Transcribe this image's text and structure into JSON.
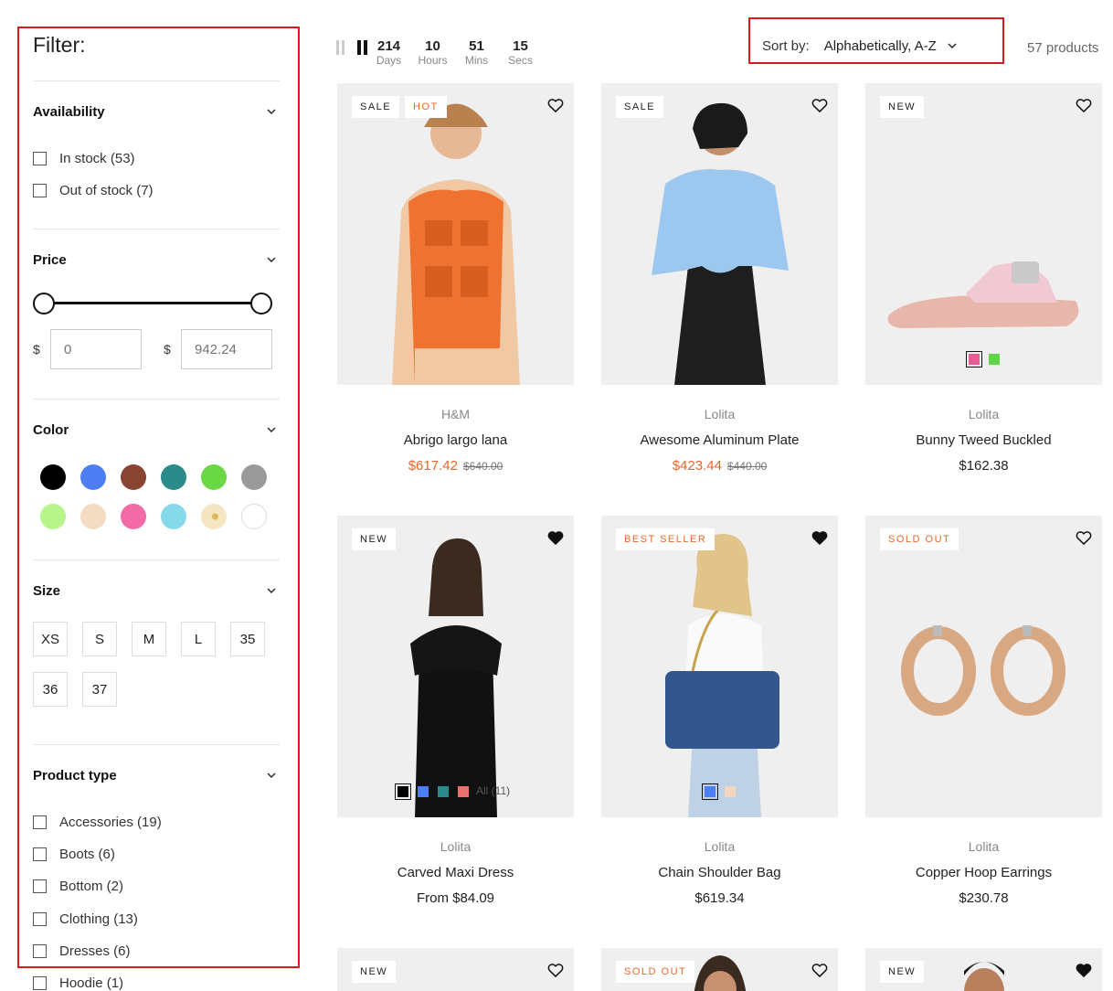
{
  "filter": {
    "title": "Filter:",
    "availability": {
      "label": "Availability",
      "options": [
        "In stock (53)",
        "Out of stock (7)"
      ]
    },
    "price": {
      "label": "Price",
      "currency": "$",
      "min_placeholder": "0",
      "max_placeholder": "942.24"
    },
    "color": {
      "label": "Color",
      "swatches": [
        "#000000",
        "#4d7ef5",
        "#8a4432",
        "#2b8a8a",
        "#6ad845",
        "#9a9a9a",
        "#b7f58a",
        "#f3dcc2",
        "#f26aa6",
        "#86d9e8",
        "#f3e6c0",
        "#ffffff"
      ]
    },
    "size": {
      "label": "Size",
      "options": [
        "XS",
        "S",
        "M",
        "L",
        "35",
        "36",
        "37"
      ]
    },
    "product_type": {
      "label": "Product type",
      "options": [
        "Accessories (19)",
        "Boots (6)",
        "Bottom (2)",
        "Clothing (13)",
        "Dresses (6)",
        "Hoodie (1)"
      ]
    }
  },
  "toolbar": {
    "sort_label": "Sort by:",
    "sort_value": "Alphabetically, A-Z",
    "count": "57 products"
  },
  "products": [
    {
      "badges": [
        "SALE",
        "HOT"
      ],
      "vendor": "H&M",
      "name": "Abrigo largo lana",
      "price": "$617.42",
      "compare": "$640.00",
      "countdown": [
        {
          "n": "214",
          "l": "Days"
        },
        {
          "n": "10",
          "l": "Hours"
        },
        {
          "n": "51",
          "l": "Mins"
        },
        {
          "n": "15",
          "l": "Secs"
        }
      ]
    },
    {
      "badges": [
        "SALE"
      ],
      "vendor": "Lolita",
      "name": "Awesome Aluminum Plate",
      "price": "$423.44",
      "compare": "$440.00"
    },
    {
      "badges": [
        "NEW"
      ],
      "vendor": "Lolita",
      "name": "Bunny Tweed Buckled",
      "price": "$162.38",
      "swatch_colors": [
        "#ea5b93",
        "#5ed645"
      ]
    },
    {
      "badges": [
        "NEW"
      ],
      "vendor": "Lolita",
      "name": "Carved Maxi Dress",
      "price": "From $84.09",
      "swatch_colors": [
        "#000000",
        "#4d7ef5",
        "#2b8a8a",
        "#e8706e"
      ],
      "swatch_all": "All (11)"
    },
    {
      "badges": [
        "BEST SELLER"
      ],
      "vendor": "Lolita",
      "name": "Chain Shoulder Bag",
      "price": "$619.34",
      "swatch_colors": [
        "#4d7ef5",
        "#f3d5c0"
      ]
    },
    {
      "badges": [
        "SOLD OUT"
      ],
      "vendor": "Lolita",
      "name": "Copper Hoop Earrings",
      "price": "$230.78"
    },
    {
      "badges": [
        "NEW"
      ]
    },
    {
      "badges": [
        "SOLD OUT"
      ]
    },
    {
      "badges": [
        "NEW"
      ]
    }
  ]
}
